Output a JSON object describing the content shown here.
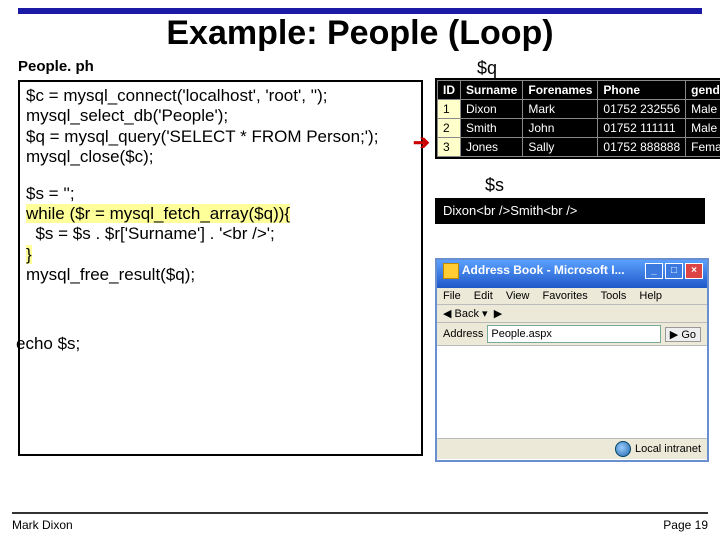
{
  "title": "Example: People (Loop)",
  "filelabel": "People. ph",
  "filelabel2": "p",
  "code": {
    "l1": "$c = mysql_connect('localhost', 'root', '');",
    "l2": "mysql_select_db('People');",
    "l3": "$q = mysql_query('SELECT * FROM Person;');",
    "l4": "mysql_close($c);",
    "l5": "$s = '';",
    "l6a": "while ($r = mysql_fetch_array($q)){",
    "l7": "  $s = $s . $r['Surname'] . '<br />';",
    "l8": "}",
    "l9": "mysql_free_result($q);",
    "l10": "echo $s;"
  },
  "labels": {
    "q": "$q",
    "s": "$s"
  },
  "qtable": {
    "headers": [
      "ID",
      "Surname",
      "Forenames",
      "Phone",
      "gender"
    ],
    "rows": [
      [
        "1",
        "Dixon",
        "Mark",
        "01752 232556",
        "Male"
      ],
      [
        "2",
        "Smith",
        "John",
        "01752 111111",
        "Male"
      ],
      [
        "3",
        "Jones",
        "Sally",
        "01752 888888",
        "Female"
      ]
    ]
  },
  "sbox": "Dixon<br />Smith<br />",
  "browser": {
    "title": "Address Book - Microsoft I...",
    "menu": [
      "File",
      "Edit",
      "View",
      "Favorites",
      "Tools",
      "Help"
    ],
    "back": "Back",
    "addr_label": "Address",
    "addr_value": "People.aspx",
    "go": "Go",
    "status": "Local intranet"
  },
  "footer": {
    "left": "Mark Dixon",
    "right": "Page 19"
  }
}
